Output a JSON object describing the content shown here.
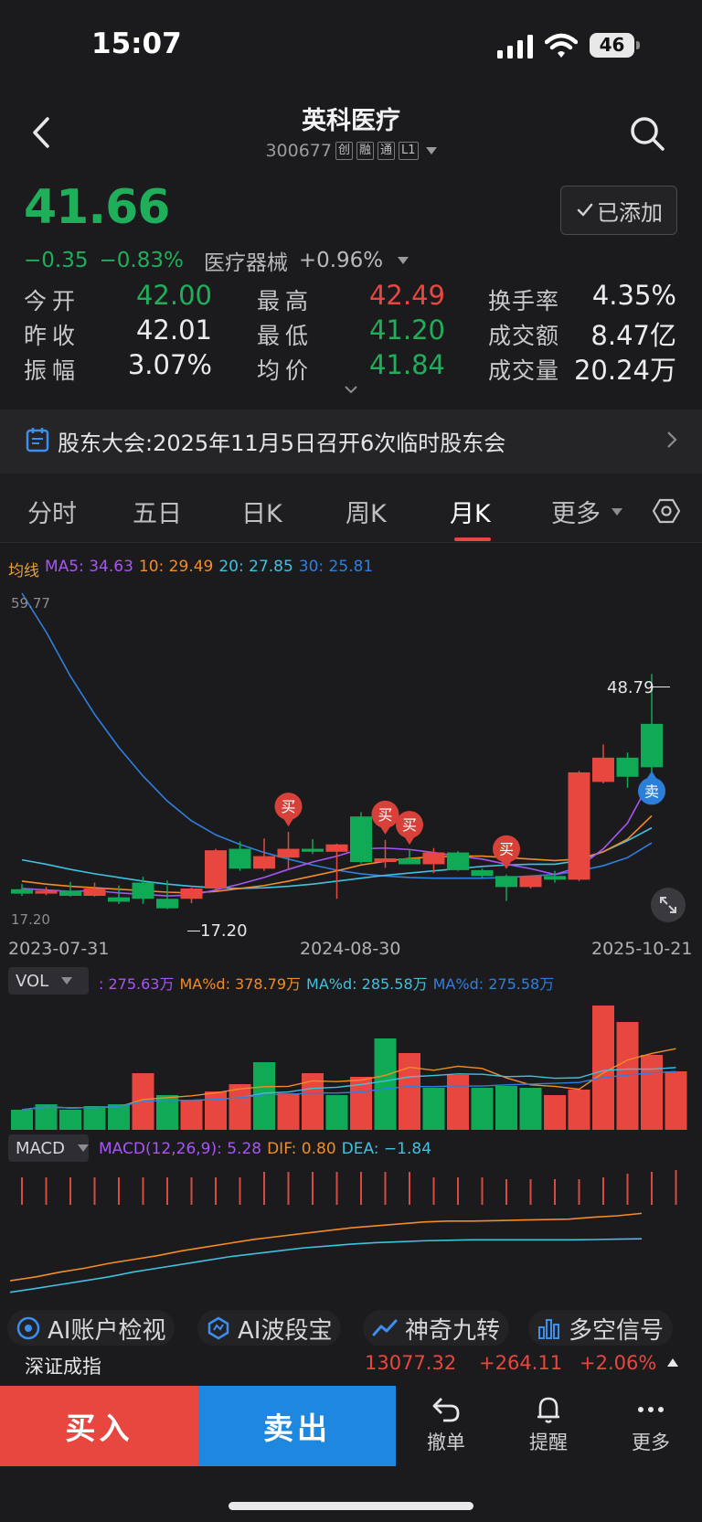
{
  "status": {
    "time": "15:07",
    "battery": "46"
  },
  "header": {
    "name": "英科医疗",
    "code": "300677",
    "tags": [
      "创",
      "融",
      "通",
      "L1"
    ]
  },
  "quote": {
    "price": "41.66",
    "change": "−0.35",
    "change_pct": "−0.83%",
    "sector": "医疗器械",
    "sector_change": "+0.96%",
    "added_label": "已添加",
    "stats": [
      {
        "label": "今开",
        "value": "42.00",
        "color": "green"
      },
      {
        "label": "最高",
        "value": "42.49",
        "color": "red"
      },
      {
        "label": "换手率",
        "value": "4.35%",
        "color": "white"
      },
      {
        "label": "昨收",
        "value": "42.01",
        "color": "white"
      },
      {
        "label": "最低",
        "value": "41.20",
        "color": "green"
      },
      {
        "label": "成交额",
        "value": "8.47亿",
        "color": "white"
      },
      {
        "label": "振幅",
        "value": "3.07%",
        "color": "white"
      },
      {
        "label": "均价",
        "value": "41.84",
        "color": "green"
      },
      {
        "label": "成交量",
        "value": "20.24万",
        "color": "white"
      }
    ]
  },
  "notice": {
    "text": "股东大会:2025年11月5日召开6次临时股东会"
  },
  "tabs": [
    "分时",
    "五日",
    "日K",
    "周K",
    "月K",
    "更多"
  ],
  "active_tab": "月K",
  "ma_legend": {
    "label": "均线",
    "ma5": "MA5: 34.63",
    "ma10": "10: 29.49",
    "ma20": "20: 27.85",
    "ma30": "30: 25.81",
    "colors": {
      "label": "#e6a23c",
      "ma5": "#a855f7",
      "ma10": "#f28c28",
      "ma20": "#3fc1e0",
      "ma30": "#2f7fe0"
    }
  },
  "chart_data": [
    {
      "type": "candlestick",
      "axis_top_label": "59.77",
      "axis_bottom_label": "17.20",
      "high_marker": "48.79",
      "low_marker": "17.20",
      "x_labels": [
        "2023-07-31",
        "2024-08-30",
        "2025-10-21"
      ],
      "buy_label": "买",
      "sell_label": "卖",
      "ohlc": [
        {
          "o": 19.5,
          "h": 20.2,
          "l": 18.6,
          "c": 18.9
        },
        {
          "o": 18.9,
          "h": 19.8,
          "l": 18.7,
          "c": 19.3
        },
        {
          "o": 19.3,
          "h": 20.5,
          "l": 18.5,
          "c": 18.6
        },
        {
          "o": 18.6,
          "h": 20.4,
          "l": 18.5,
          "c": 19.6
        },
        {
          "o": 18.4,
          "h": 20.0,
          "l": 17.5,
          "c": 17.8
        },
        {
          "o": 20.4,
          "h": 21.2,
          "l": 17.5,
          "c": 18.2
        },
        {
          "o": 18.2,
          "h": 20.7,
          "l": 16.8,
          "c": 16.9
        },
        {
          "o": 18.2,
          "h": 19.7,
          "l": 17.6,
          "c": 19.6
        },
        {
          "o": 19.6,
          "h": 25.0,
          "l": 19.3,
          "c": 24.8
        },
        {
          "o": 25.0,
          "h": 26.0,
          "l": 22.0,
          "c": 22.3
        },
        {
          "o": 22.3,
          "h": 26.4,
          "l": 22.0,
          "c": 24.0
        },
        {
          "o": 23.8,
          "h": 27.3,
          "l": 22.2,
          "c": 25.0
        },
        {
          "o": 25.0,
          "h": 26.3,
          "l": 24.3,
          "c": 24.6
        },
        {
          "o": 24.6,
          "h": 25.7,
          "l": 18.2,
          "c": 25.6
        },
        {
          "o": 29.4,
          "h": 30.0,
          "l": 23.0,
          "c": 23.2
        },
        {
          "o": 23.2,
          "h": 26.2,
          "l": 22.4,
          "c": 23.7
        },
        {
          "o": 23.7,
          "h": 24.8,
          "l": 22.9,
          "c": 22.9
        },
        {
          "o": 22.9,
          "h": 25.1,
          "l": 21.7,
          "c": 24.5
        },
        {
          "o": 24.5,
          "h": 24.7,
          "l": 22.0,
          "c": 22.1
        },
        {
          "o": 22.1,
          "h": 22.3,
          "l": 21.0,
          "c": 21.3
        },
        {
          "o": 21.3,
          "h": 21.5,
          "l": 17.9,
          "c": 19.8
        },
        {
          "o": 19.8,
          "h": 21.3,
          "l": 19.6,
          "c": 21.3
        },
        {
          "o": 21.3,
          "h": 22.0,
          "l": 20.4,
          "c": 20.8
        },
        {
          "o": 20.8,
          "h": 35.6,
          "l": 20.6,
          "c": 35.4
        },
        {
          "o": 34.1,
          "h": 39.2,
          "l": 33.9,
          "c": 37.4
        },
        {
          "o": 37.4,
          "h": 38.1,
          "l": 33.3,
          "c": 34.8
        },
        {
          "o": 42.0,
          "h": 48.79,
          "l": 34.1,
          "c": 36.1
        }
      ],
      "ma5": [
        19.6,
        19.4,
        19.2,
        19.3,
        19.0,
        18.8,
        18.6,
        18.7,
        19.4,
        20.2,
        21.1,
        22.2,
        23.2,
        24.0,
        25.0,
        25.1,
        24.9,
        24.5,
        24.0,
        23.6,
        22.9,
        22.3,
        21.5,
        22.5,
        25.0,
        28.5,
        34.63
      ],
      "ma10": [
        20.6,
        20.2,
        19.9,
        19.7,
        19.5,
        19.3,
        19.1,
        19.0,
        19.2,
        19.6,
        20.0,
        20.6,
        21.3,
        22.0,
        22.8,
        23.3,
        23.7,
        23.9,
        24.0,
        24.0,
        23.8,
        23.6,
        23.4,
        23.6,
        24.6,
        26.3,
        29.49
      ],
      "ma20": [
        23.5,
        22.9,
        22.2,
        21.6,
        21.1,
        20.6,
        20.2,
        19.9,
        19.7,
        19.6,
        19.7,
        19.9,
        20.2,
        20.6,
        21.0,
        21.4,
        21.7,
        22.0,
        22.3,
        22.6,
        22.8,
        22.9,
        22.9,
        23.4,
        24.6,
        26.1,
        27.85
      ],
      "ma30": [
        59.77,
        54.5,
        48.5,
        43.3,
        38.8,
        34.9,
        31.5,
        28.8,
        26.9,
        25.6,
        24.5,
        23.6,
        22.8,
        22.1,
        21.6,
        21.3,
        21.1,
        21.0,
        21.0,
        21.0,
        21.1,
        21.3,
        21.5,
        22.0,
        22.7,
        23.8,
        25.81
      ],
      "buy_signals": [
        11,
        15,
        16,
        20
      ],
      "sell_signals": [
        26
      ]
    },
    {
      "type": "bar",
      "label": "VOL",
      "legend": [
        ": 275.63万",
        "MA%d: 378.79万",
        "MA%d: 285.58万",
        "MA%d: 275.58万"
      ],
      "legend_colors": [
        "#a855f7",
        "#f28c28",
        "#3fc1e0",
        "#2f7fe0"
      ],
      "values": [
        22,
        28,
        22,
        26,
        28,
        62,
        38,
        32,
        42,
        50,
        74,
        40,
        62,
        38,
        58,
        100,
        84,
        46,
        60,
        46,
        48,
        46,
        38,
        44,
        136,
        118,
        82,
        64
      ],
      "up": [
        0,
        0,
        0,
        0,
        0,
        1,
        0,
        1,
        1,
        1,
        0,
        1,
        1,
        0,
        1,
        0,
        1,
        0,
        1,
        0,
        0,
        0,
        1,
        1,
        1,
        1,
        1,
        1
      ]
    },
    {
      "type": "bar",
      "label": "MACD",
      "legend": [
        "MACD(12,26,9): 5.28",
        "DIF: 0.80",
        "DEA: −1.84"
      ],
      "legend_colors": [
        "#a855f7",
        "#f28c28",
        "#3fc1e0"
      ],
      "values": [
        30,
        30,
        30,
        30,
        30,
        30,
        30,
        30,
        30,
        30,
        36,
        36,
        36,
        36,
        36,
        36,
        36,
        30,
        30,
        30,
        28,
        28,
        28,
        28,
        30,
        34,
        36,
        38
      ],
      "dif": [
        -6.2,
        -5.8,
        -5.3,
        -4.9,
        -4.4,
        -4.0,
        -3.6,
        -3.1,
        -2.7,
        -2.3,
        -1.9,
        -1.6,
        -1.3,
        -1.0,
        -0.7,
        -0.5,
        -0.3,
        -0.1,
        0.0,
        0.0,
        0.05,
        0.1,
        0.15,
        0.2,
        0.4,
        0.55,
        0.8
      ],
      "dea": [
        -7.4,
        -7.0,
        -6.6,
        -6.2,
        -5.8,
        -5.3,
        -4.9,
        -4.5,
        -4.1,
        -3.7,
        -3.4,
        -3.1,
        -2.8,
        -2.6,
        -2.4,
        -2.25,
        -2.15,
        -2.05,
        -2.0,
        -1.95,
        -1.95,
        -1.95,
        -1.95,
        -1.95,
        -1.92,
        -1.88,
        -1.84
      ]
    }
  ],
  "features": [
    "AI账户检视",
    "AI波段宝",
    "神奇九转",
    "多空信号"
  ],
  "index_bar": {
    "name": "深证成指",
    "value": "13077.32",
    "change": "+264.11",
    "change_pct": "+2.06%"
  },
  "actions": {
    "buy": "买入",
    "sell": "卖出",
    "cancel": "撤单",
    "alert": "提醒",
    "more": "更多"
  }
}
